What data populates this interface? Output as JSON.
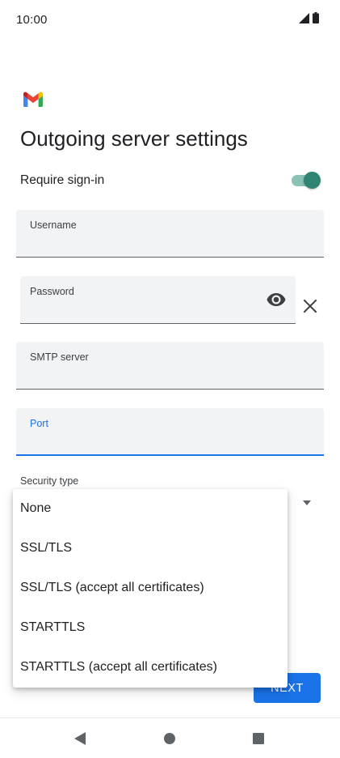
{
  "status_bar": {
    "time": "10:00",
    "icons": [
      "signal-icon",
      "battery-icon"
    ]
  },
  "app": {
    "logo": "gmail-logo"
  },
  "page": {
    "title": "Outgoing server settings"
  },
  "require_signin": {
    "label": "Require sign-in",
    "enabled": true,
    "accent_color": "#2f8472"
  },
  "fields": {
    "username": {
      "label": "Username",
      "value": ""
    },
    "password": {
      "label": "Password",
      "value": ""
    },
    "smtp_server": {
      "label": "SMTP server",
      "value": ""
    },
    "port": {
      "label": "Port",
      "value": "",
      "focused": true
    }
  },
  "security": {
    "label": "Security type",
    "options": [
      "None",
      "SSL/TLS",
      "SSL/TLS (accept all certificates)",
      "STARTTLS",
      "STARTTLS (accept all certificates)"
    ]
  },
  "actions": {
    "next_label": "NEXT",
    "accent_color": "#1a73e8"
  },
  "nav": {
    "icons": [
      "back-icon",
      "home-icon",
      "recents-icon"
    ]
  }
}
